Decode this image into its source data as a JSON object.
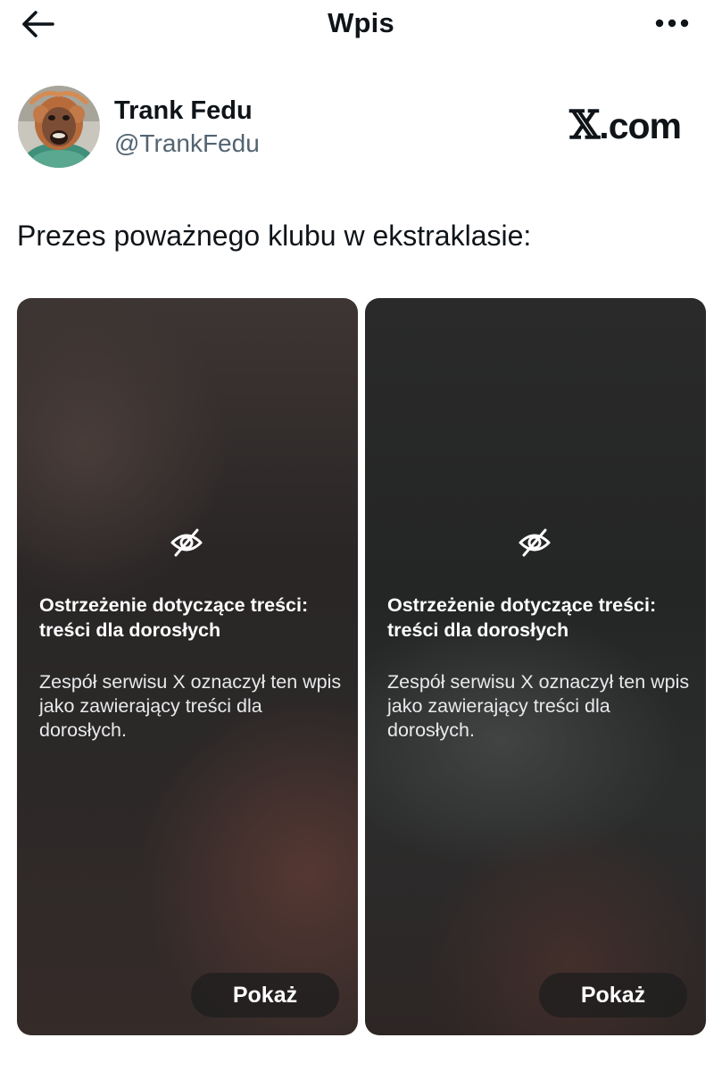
{
  "header": {
    "title": "Wpis",
    "back_icon": "arrow-left-icon",
    "more_icon": "more-horizontal-icon"
  },
  "author": {
    "name": "Trank Fedu",
    "handle": "@TrankFedu",
    "avatar": "orangutan-avatar"
  },
  "site_badge": {
    "x_glyph": "𝕏",
    "suffix": ".com"
  },
  "post": {
    "text": "Prezes poważnego klubu w ekstraklasie:"
  },
  "media": [
    {
      "icon": "eye-slash-icon",
      "warning_title": "Ostrzeżenie dotyczące treści: treści dla dorosłych",
      "warning_body": "Zespół serwisu X oznaczył ten wpis jako zawierający treści dla dorosłych.",
      "show_label": "Pokaż"
    },
    {
      "icon": "eye-slash-icon",
      "warning_title": "Ostrzeżenie dotyczące treści: treści dla dorosłych",
      "warning_body": "Zespół serwisu X oznaczył ten wpis jako zawierający treści dla dorosłych.",
      "show_label": "Pokaż"
    }
  ],
  "colors": {
    "text": "#0f1419",
    "secondary_text": "#536471",
    "overlay_text": "#ffffff"
  }
}
